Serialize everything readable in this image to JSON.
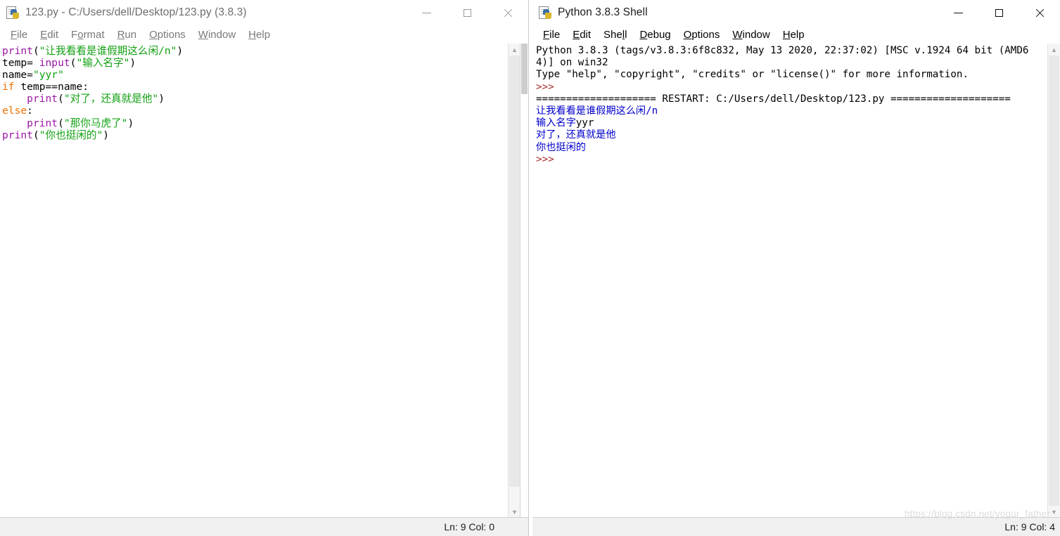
{
  "editor_window": {
    "title": "123.py - C:/Users/dell/Desktop/123.py (3.8.3)",
    "icon": "python-idle-icon",
    "menus": [
      {
        "prefix": "",
        "mnemonic": "F",
        "rest": "ile"
      },
      {
        "prefix": "",
        "mnemonic": "E",
        "rest": "dit"
      },
      {
        "prefix": "F",
        "mnemonic": "o",
        "rest": "rmat"
      },
      {
        "prefix": "",
        "mnemonic": "R",
        "rest": "un"
      },
      {
        "prefix": "",
        "mnemonic": "O",
        "rest": "ptions"
      },
      {
        "prefix": "",
        "mnemonic": "W",
        "rest": "indow"
      },
      {
        "prefix": "",
        "mnemonic": "H",
        "rest": "elp"
      }
    ],
    "controls": {
      "minimize": "minimize",
      "maximize": "maximize",
      "close": "close"
    },
    "code_lines": [
      [
        {
          "t": "print",
          "c": "builtin"
        },
        {
          "t": "(",
          "c": "plain"
        },
        {
          "t": "\"让我看看是谁假期这么闲/n\"",
          "c": "string"
        },
        {
          "t": ")",
          "c": "plain"
        }
      ],
      [
        {
          "t": "temp= ",
          "c": "plain"
        },
        {
          "t": "input",
          "c": "builtin"
        },
        {
          "t": "(",
          "c": "plain"
        },
        {
          "t": "\"输入名字\"",
          "c": "string"
        },
        {
          "t": ")",
          "c": "plain"
        }
      ],
      [
        {
          "t": "name=",
          "c": "plain"
        },
        {
          "t": "\"yyr\"",
          "c": "string"
        }
      ],
      [
        {
          "t": "if",
          "c": "keyword"
        },
        {
          "t": " temp==name:",
          "c": "plain"
        }
      ],
      [
        {
          "t": "    ",
          "c": "plain"
        },
        {
          "t": "print",
          "c": "builtin"
        },
        {
          "t": "(",
          "c": "plain"
        },
        {
          "t": "\"对了，还真就是他\"",
          "c": "string"
        },
        {
          "t": ")",
          "c": "plain"
        }
      ],
      [
        {
          "t": "else",
          "c": "keyword"
        },
        {
          "t": ":",
          "c": "plain"
        }
      ],
      [
        {
          "t": "    ",
          "c": "plain"
        },
        {
          "t": "print",
          "c": "builtin"
        },
        {
          "t": "(",
          "c": "plain"
        },
        {
          "t": "\"那你马虎了\"",
          "c": "string"
        },
        {
          "t": ")",
          "c": "plain"
        }
      ],
      [
        {
          "t": "print",
          "c": "builtin"
        },
        {
          "t": "(",
          "c": "plain"
        },
        {
          "t": "\"你也挺闲的\"",
          "c": "string"
        },
        {
          "t": ")",
          "c": "plain"
        }
      ]
    ],
    "status": "Ln: 9  Col: 0"
  },
  "shell_window": {
    "title": "Python 3.8.3 Shell",
    "icon": "python-idle-icon",
    "menus": [
      {
        "prefix": "",
        "mnemonic": "F",
        "rest": "ile"
      },
      {
        "prefix": "",
        "mnemonic": "E",
        "rest": "dit"
      },
      {
        "prefix": "She",
        "mnemonic": "l",
        "rest": "l"
      },
      {
        "prefix": "",
        "mnemonic": "D",
        "rest": "ebug"
      },
      {
        "prefix": "",
        "mnemonic": "O",
        "rest": "ptions"
      },
      {
        "prefix": "",
        "mnemonic": "W",
        "rest": "indow"
      },
      {
        "prefix": "",
        "mnemonic": "H",
        "rest": "elp"
      }
    ],
    "controls": {
      "minimize": "minimize",
      "maximize": "maximize",
      "close": "close"
    },
    "shell_lines": [
      [
        {
          "t": "Python 3.8.3 (tags/v3.8.3:6f8c832, May 13 2020, 22:37:02) [MSC v.1924 64 bit (AMD64)] on win32",
          "c": "black"
        }
      ],
      [
        {
          "t": "Type \"help\", \"copyright\", \"credits\" or \"license()\" for more information.",
          "c": "black"
        }
      ],
      [
        {
          "t": ">>>",
          "c": "prompt"
        }
      ],
      [
        {
          "t": "==================== RESTART: C:/Users/dell/Desktop/123.py ====================",
          "c": "black"
        }
      ],
      [
        {
          "t": "让我看看是谁假期这么闲/n",
          "c": "output"
        }
      ],
      [
        {
          "t": "输入名字",
          "c": "output"
        },
        {
          "t": "yyr",
          "c": "black"
        }
      ],
      [
        {
          "t": "对了，还真就是他",
          "c": "output"
        }
      ],
      [
        {
          "t": "你也挺闲的",
          "c": "output"
        }
      ],
      [
        {
          "t": ">>>",
          "c": "prompt"
        }
      ]
    ],
    "status": "Ln: 9  Col: 4"
  },
  "watermark": "https://blog.csdn.net/yogur_father",
  "colors": {
    "builtin": "#9a17a3",
    "string": "#12a012",
    "keyword": "#f07000",
    "output": "#0000cc",
    "prompt": "#a52a2a",
    "plain": "#000000"
  }
}
